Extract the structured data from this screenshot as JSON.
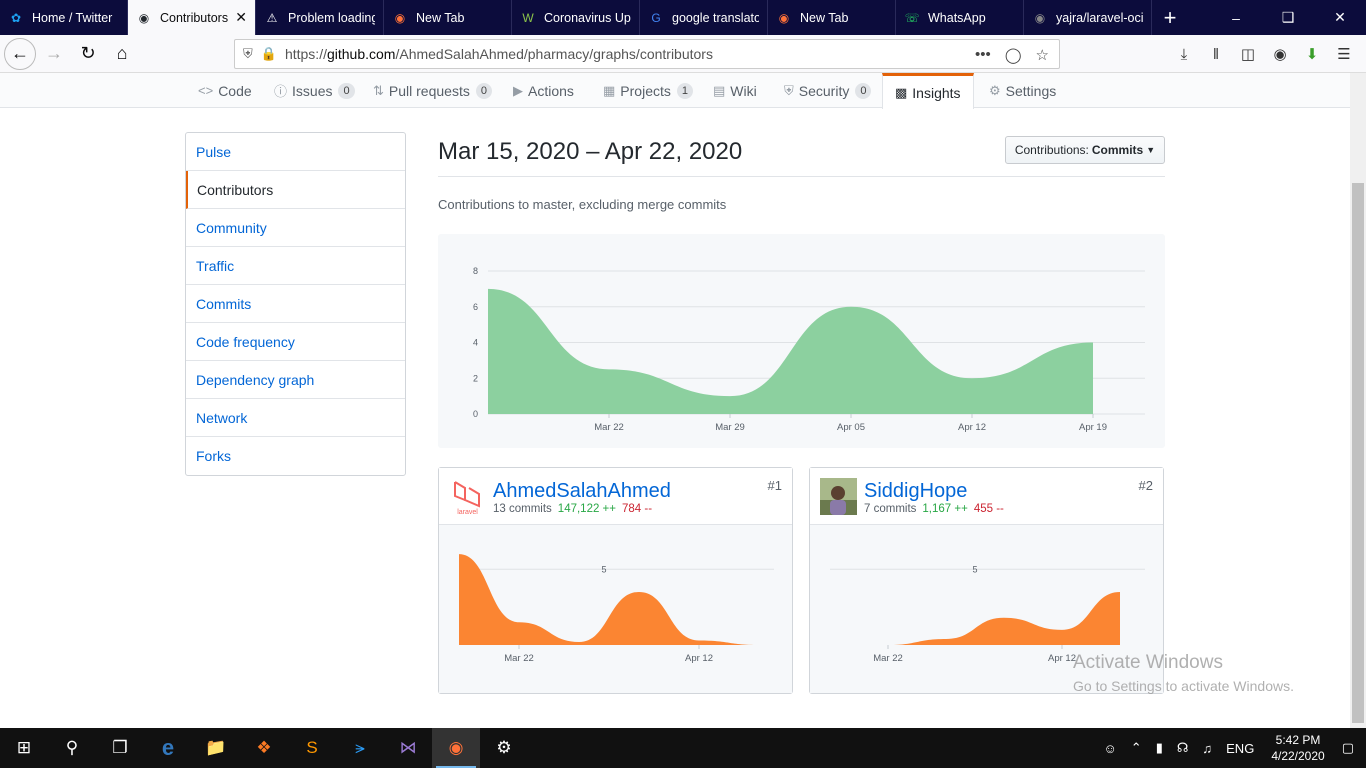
{
  "browser": {
    "tabs": [
      {
        "label": "Home / Twitter",
        "icon": "twitter-icon",
        "color": "#1da1f2"
      },
      {
        "label": "Contributors",
        "icon": "github-icon",
        "color": "#24292e",
        "active": true
      },
      {
        "label": "Problem loading",
        "icon": "warning-icon",
        "color": "#ffffff"
      },
      {
        "label": "New Tab",
        "icon": "firefox-icon",
        "color": "#ff7139"
      },
      {
        "label": "Coronavirus Up",
        "icon": "worldometer-icon",
        "color": "#8bc34a"
      },
      {
        "label": "google translato",
        "icon": "google-icon",
        "color": "#4285f4"
      },
      {
        "label": "New Tab",
        "icon": "firefox-icon",
        "color": "#ff7139"
      },
      {
        "label": "WhatsApp",
        "icon": "whatsapp-icon",
        "color": "#25d366"
      },
      {
        "label": "yajra/laravel-oci",
        "icon": "github-icon",
        "color": "#888888"
      }
    ],
    "url_prefix": "https://",
    "url_host": "github.com",
    "url_path": "/AhmedSalahAhmed/pharmacy/graphs/contributors"
  },
  "repo_nav": {
    "code": "Code",
    "issues": "Issues",
    "issues_count": "0",
    "pulls": "Pull requests",
    "pulls_count": "0",
    "actions": "Actions",
    "projects": "Projects",
    "projects_count": "1",
    "wiki": "Wiki",
    "security": "Security",
    "security_count": "0",
    "insights": "Insights",
    "settings": "Settings"
  },
  "sidebar": {
    "items": [
      "Pulse",
      "Contributors",
      "Community",
      "Traffic",
      "Commits",
      "Code frequency",
      "Dependency graph",
      "Network",
      "Forks"
    ],
    "selected": "Contributors"
  },
  "main": {
    "date_range": "Mar 15, 2020 – Apr 22, 2020",
    "contrib_label": "Contributions:",
    "contrib_value": "Commits",
    "subtitle": "Contributions to master, excluding merge commits"
  },
  "chart_data": [
    {
      "type": "area",
      "title": "",
      "x": [
        "Mar 15",
        "Mar 22",
        "Mar 29",
        "Apr 05",
        "Apr 12",
        "Apr 19"
      ],
      "values": [
        7,
        2.5,
        1,
        6,
        2,
        4
      ],
      "ylim": [
        0,
        8
      ],
      "yticks": [
        0,
        2,
        4,
        6,
        8
      ],
      "xtick_labels": [
        "Mar 22",
        "Mar 29",
        "Apr 05",
        "Apr 12",
        "Apr 19"
      ],
      "color": "#8cd09f",
      "grid": true
    },
    {
      "type": "area",
      "title": "AhmedSalahAhmed",
      "x": [
        "Mar 15",
        "Mar 22",
        "Mar 29",
        "Apr 05",
        "Apr 12",
        "Apr 19"
      ],
      "values": [
        6,
        1.5,
        0.2,
        3.5,
        0.3,
        0
      ],
      "ylim": [
        0,
        7
      ],
      "yticks": [
        5
      ],
      "xtick_labels": [
        "Mar 22",
        "Apr 12"
      ],
      "color": "#fb8532",
      "grid": true
    },
    {
      "type": "area",
      "title": "SiddigHope",
      "x": [
        "Mar 15",
        "Mar 22",
        "Mar 29",
        "Apr 05",
        "Apr 12",
        "Apr 19"
      ],
      "values": [
        0,
        0,
        0.4,
        1.8,
        1,
        3.5
      ],
      "ylim": [
        0,
        7
      ],
      "yticks": [
        5
      ],
      "xtick_labels": [
        "Mar 22",
        "Apr 12"
      ],
      "color": "#fb8532",
      "grid": true
    }
  ],
  "contributors": [
    {
      "name": "AhmedSalahAhmed",
      "rank": "#1",
      "commits": "13 commits",
      "additions": "147,122 ++",
      "deletions": "784 --",
      "avatar_label": "laravel"
    },
    {
      "name": "SiddigHope",
      "rank": "#2",
      "commits": "7 commits",
      "additions": "1,167 ++",
      "deletions": "455 --"
    }
  ],
  "overlay": {
    "line1": "Activate Windows",
    "line2": "Go to Settings to activate Windows."
  },
  "taskbar": {
    "language": "ENG",
    "time": "5:42 PM",
    "date": "4/22/2020"
  }
}
